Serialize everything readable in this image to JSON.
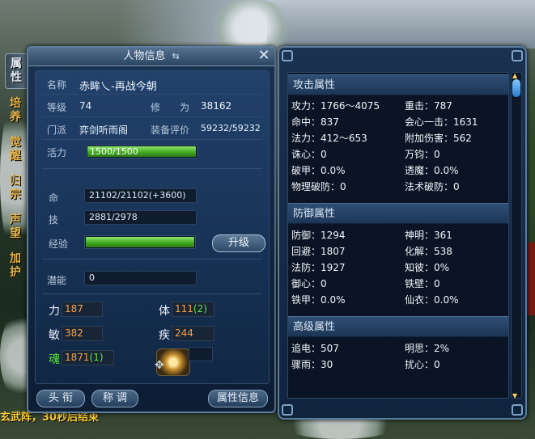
{
  "window_title": "人物信息",
  "side_tabs": [
    "属\n性",
    "培\n养",
    "觉\n醒",
    "归\n宗",
    "声\n望",
    "加\n护"
  ],
  "profile": {
    "name_label": "名称",
    "name_value": "赤眸乀-再战今朝",
    "level_label": "等级",
    "level_value": "74",
    "cultivation_label": "修　　为",
    "cultivation_value": "38162",
    "sect_label": "门派",
    "sect_value": "弈剑听雨阁",
    "gear_label": "装备评价",
    "gear_value": "59232/59232",
    "vitality_label": "活力",
    "vitality_value": "1500/1500",
    "vitality_fill": 1.0
  },
  "vitals": {
    "hp_label": "命",
    "hp_value": "21102/21102(+3600)",
    "skill_label": "技",
    "skill_value": "2881/2978",
    "exp_label": "经验",
    "exp_fill": 1.0,
    "upgrade_label": "升级",
    "potential_label": "潜能",
    "potential_value": "0"
  },
  "attributes": {
    "strength_label": "力",
    "strength_value": "187",
    "body_label": "体",
    "body_value": "111",
    "body_bonus": "(2)",
    "agility_label": "敏",
    "agility_value": "382",
    "speed_label": "疾",
    "speed_value": "244",
    "soul_label": "魂",
    "soul_value": "1871",
    "soul_bonus": "(1)"
  },
  "bottom_buttons": {
    "title_frame": "头 衔",
    "appellation": "称 调",
    "attr_info": "属性信息"
  },
  "attack": {
    "header": "攻击属性",
    "stats": [
      "攻力：1766～4075",
      "重击：787",
      "命中：837",
      "会心一击：1631",
      "法力：412～653",
      "附加伤害：562",
      "诛心：0",
      "万钧：0",
      "破甲：0.0%",
      "透魔：0.0%",
      "物理破防：0",
      "法术破防：0"
    ]
  },
  "defense": {
    "header": "防御属性",
    "stats": [
      "防御：1294",
      "神明：361",
      "回避：1807",
      "化解：538",
      "法防：1927",
      "知彼：0%",
      "御心：0",
      "铁壁：0",
      "铁甲：0.0%",
      "仙衣：0.0%"
    ]
  },
  "advanced": {
    "header": "高级属性",
    "stats": [
      "追电：507",
      "明思：2%",
      "骤雨：30",
      "扰心：0"
    ]
  },
  "bottom_notice": "玄武阵，30秒后结束"
}
